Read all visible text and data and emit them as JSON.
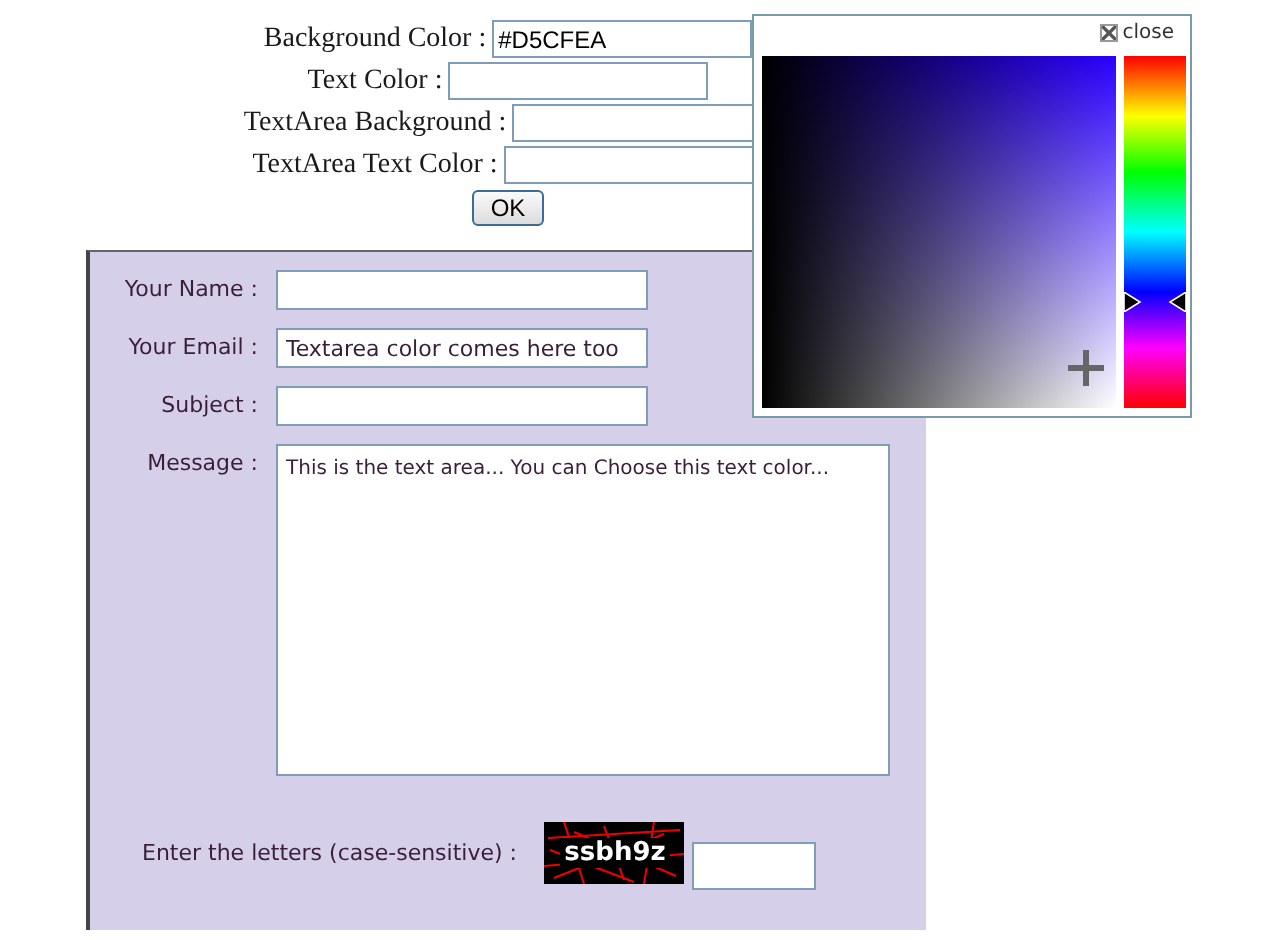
{
  "settings": {
    "fields": [
      {
        "label": "Background Color :",
        "value": "#D5CFEA"
      },
      {
        "label": "Text Color :"
      },
      {
        "label": "TextArea Background :"
      },
      {
        "label": "TextArea Text Color :"
      }
    ],
    "ok_button": "OK"
  },
  "color_picker": {
    "close": "close"
  },
  "form": {
    "fields": [
      {
        "label": "Your Name :",
        "kind": "input"
      },
      {
        "label": "Your Email :",
        "kind": "input",
        "value": "Textarea color comes here too"
      },
      {
        "label": "Subject :",
        "kind": "input"
      },
      {
        "label": "Message :",
        "kind": "textarea",
        "value": "This is the text area... You can Choose this text color..."
      }
    ],
    "captcha": {
      "label": "Enter the letters (case-sensitive) :",
      "code": "ssbh9z"
    }
  }
}
